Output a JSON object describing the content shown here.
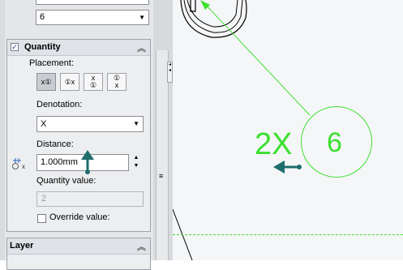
{
  "top_select": {
    "value": "6"
  },
  "quantity": {
    "title": "Quantity",
    "placement_label": "Placement:",
    "placement_options": [
      {
        "icon": "x-before-balloon-icon",
        "glyph": "x①"
      },
      {
        "icon": "x-after-balloon-icon",
        "glyph": "①x"
      },
      {
        "icon": "x-above-balloon-icon",
        "glyph": "x\n①"
      },
      {
        "icon": "x-below-balloon-icon",
        "glyph": "①\nx"
      }
    ],
    "denotation_label": "Denotation:",
    "denotation_value": "X",
    "distance_label": "Distance:",
    "distance_value": "1.000mm",
    "quantity_value_label": "Quantity value:",
    "quantity_value": "2",
    "override_label": "Override value:"
  },
  "layer": {
    "title": "Layer"
  },
  "canvas": {
    "balloon_number": "6",
    "quantity_prefix": "2X",
    "accent": "#3be02e"
  }
}
